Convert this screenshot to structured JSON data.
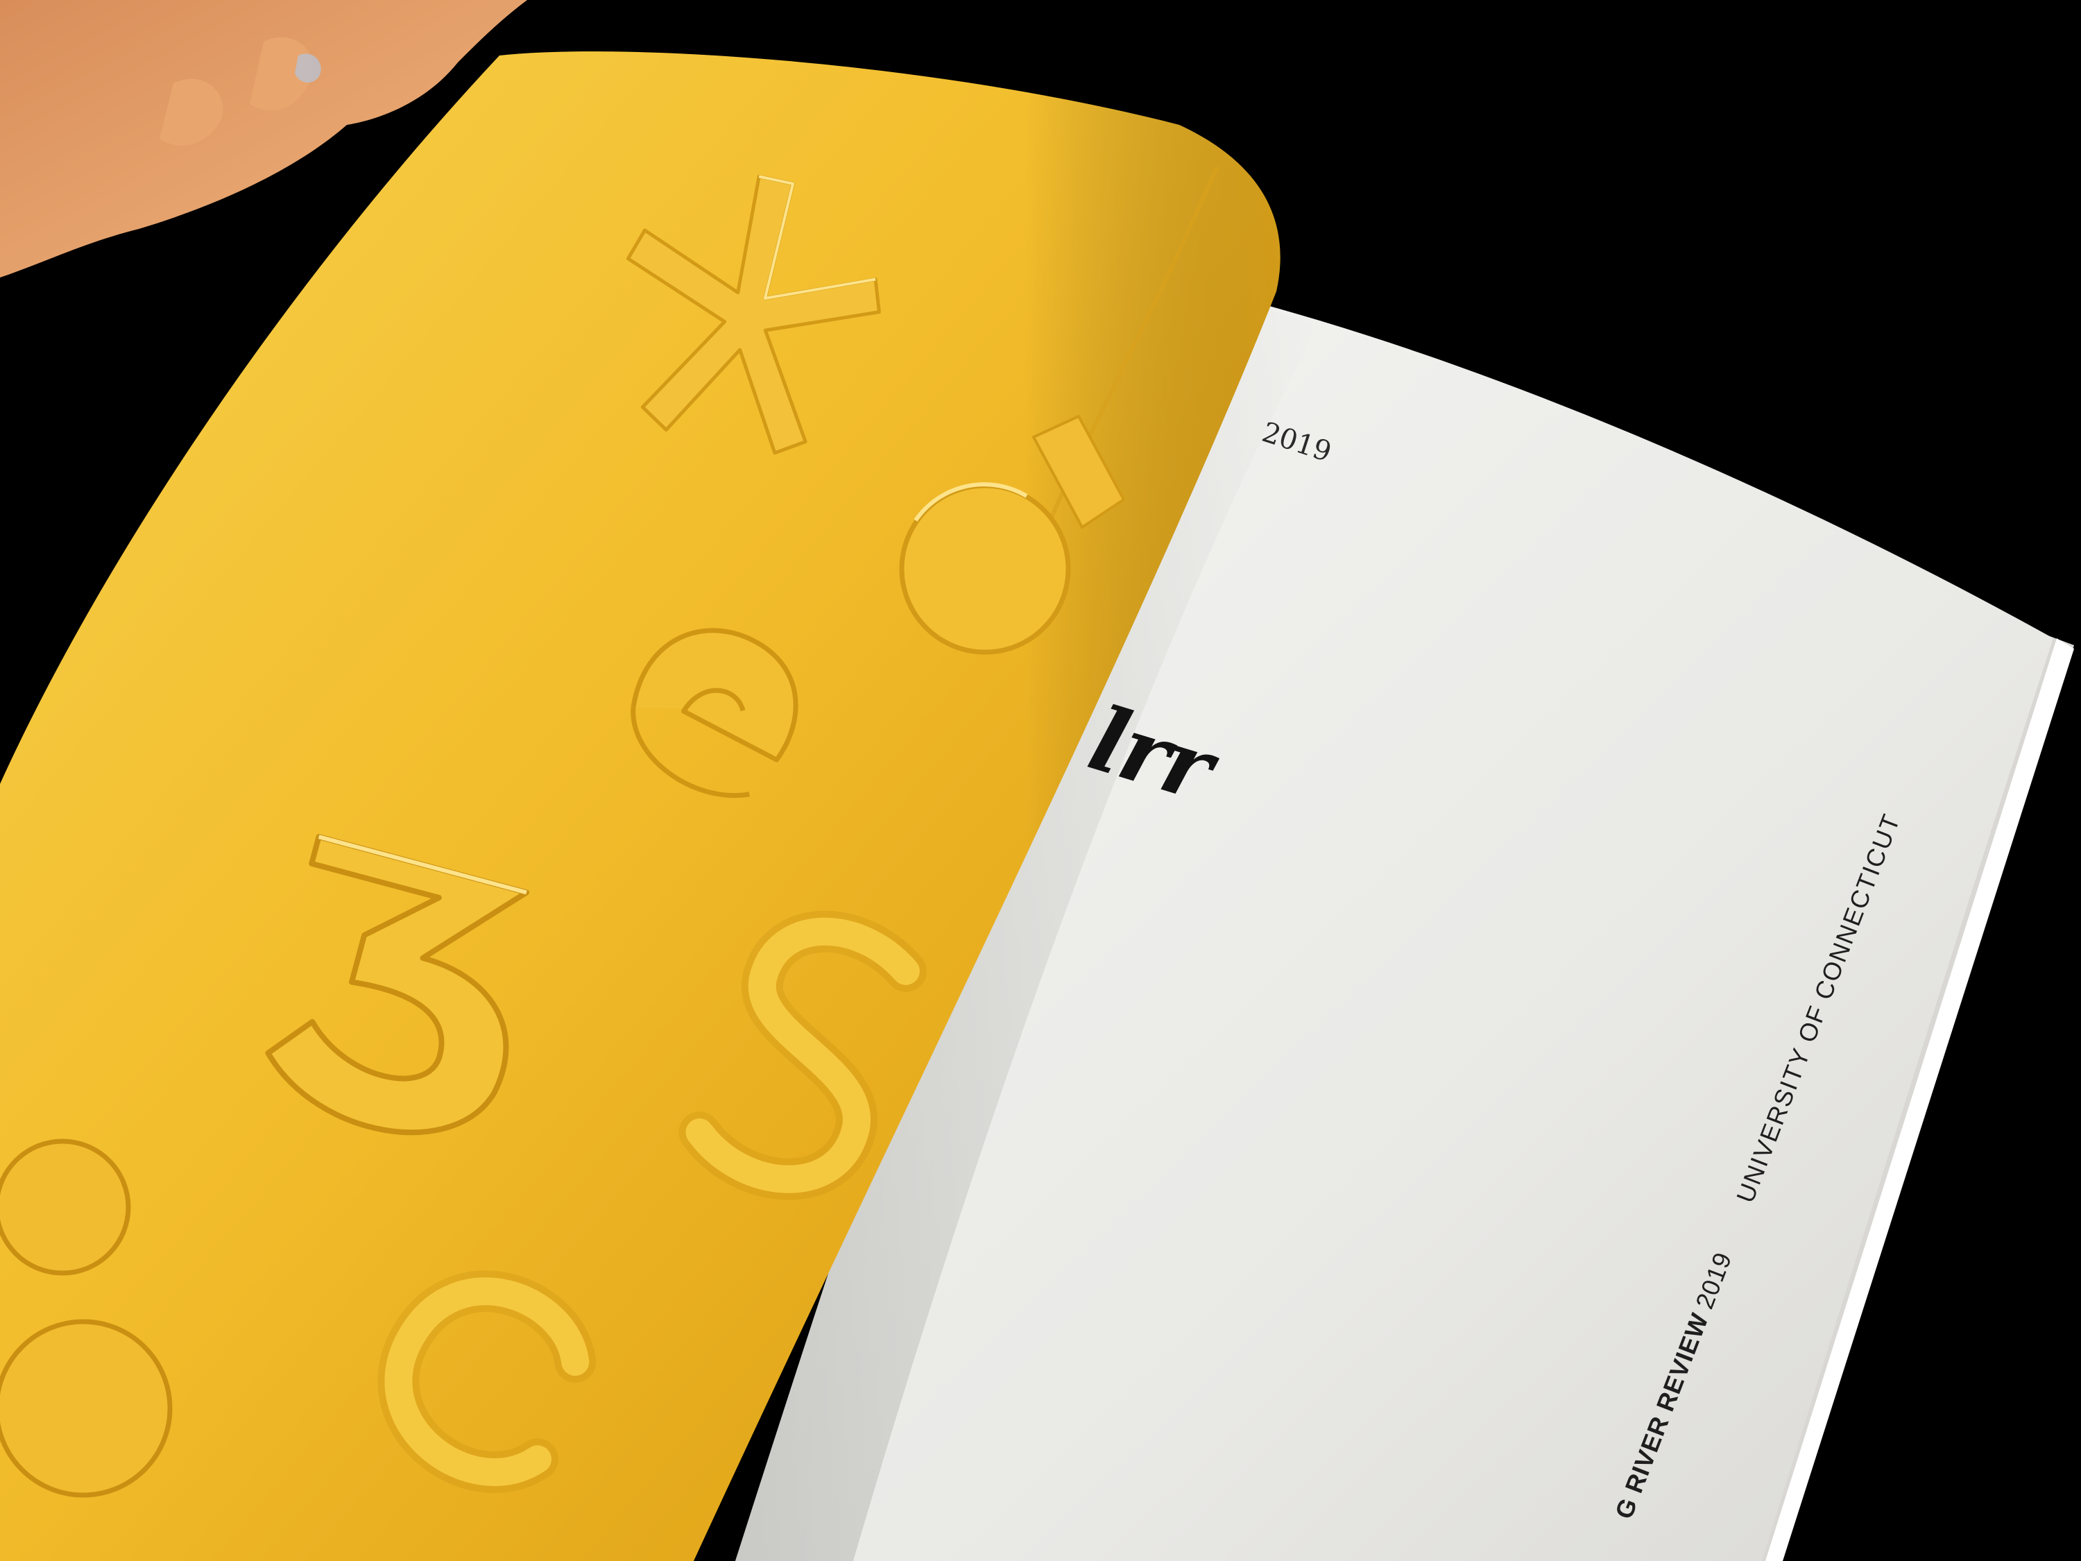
{
  "page": {
    "year": "2019",
    "logo": "lrr",
    "spine_title": "G RIVER REVIEW",
    "spine_year": "2019",
    "spine_university": "UNIVERSITY OF CONNECTICUT"
  },
  "cover": {
    "embossed_glyphs": [
      "*",
      "o",
      "e",
      "3",
      "s",
      "c",
      "o",
      "o"
    ]
  },
  "colors": {
    "background": "#000000",
    "cover_yellow": "#f0b92a",
    "page_white": "#ecebe8",
    "ink": "#121212"
  }
}
